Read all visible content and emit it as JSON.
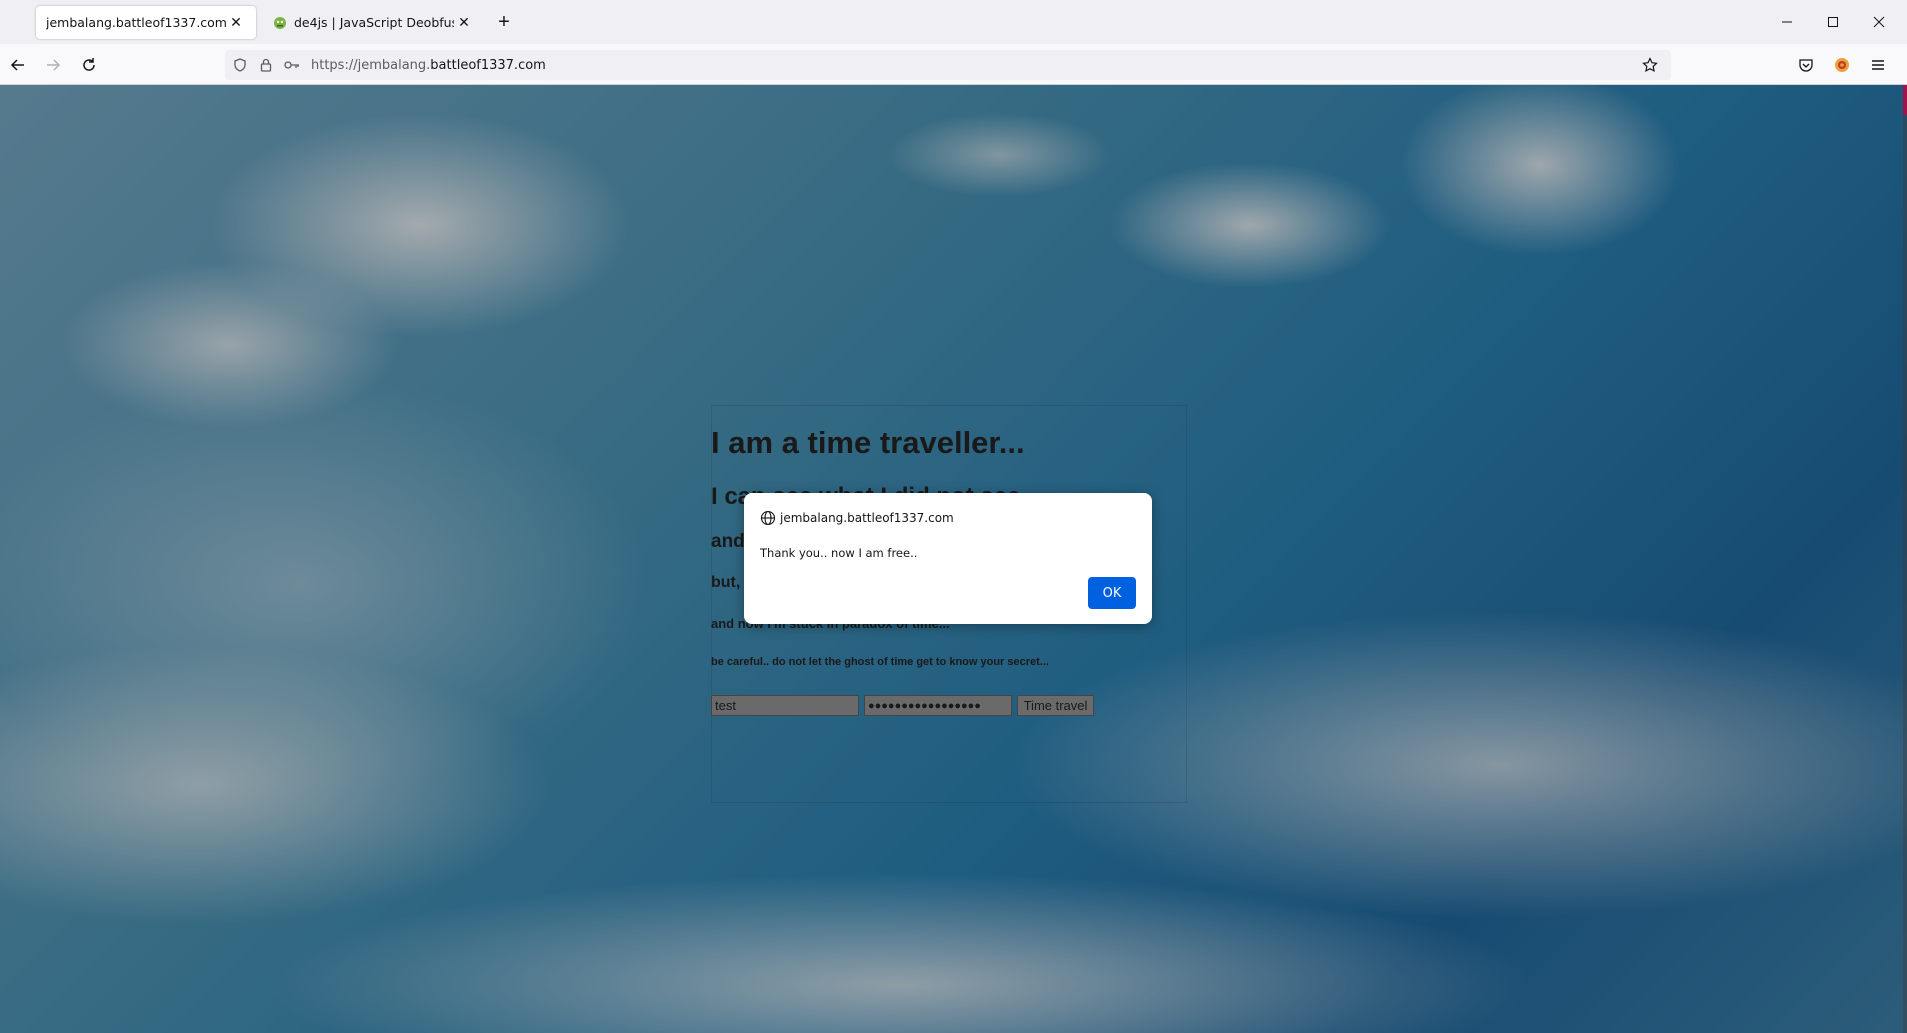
{
  "browser": {
    "tabs": [
      {
        "label": "jembalang.battleof1337.com/",
        "active": true,
        "favicon": "none"
      },
      {
        "label": "de4js | JavaScript Deobfuscator",
        "active": false,
        "favicon": "green-robot-icon"
      }
    ],
    "new_tab_symbol": "+",
    "window_controls": {
      "minimize": "—",
      "maximize": "☐",
      "close": "✕"
    },
    "url": {
      "prefix": "https://jembalang.",
      "host": "battleof1337.com"
    },
    "accent_color": "#0061e0"
  },
  "page": {
    "heading1": "I am a time traveller...",
    "heading2": "I can see what I did not see...",
    "heading3": "and",
    "heading4": "but,",
    "heading5": "and now I'm stuck in paradox of time...",
    "heading6": "be careful.. do not let the ghost of time get to know your secret...",
    "username_value": "test",
    "password_value": "●●●●●●●●●●●●●●●●●",
    "submit_label": "Time travel"
  },
  "dialog": {
    "origin": "jembalang.battleof1337.com",
    "message": "Thank you.. now I am free..",
    "ok_label": "OK"
  }
}
